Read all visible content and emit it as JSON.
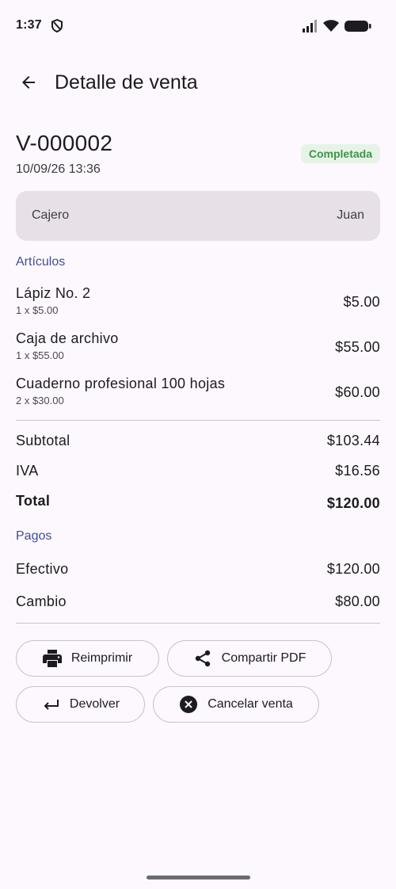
{
  "status_bar": {
    "time": "1:37"
  },
  "app_bar": {
    "title": "Detalle de venta"
  },
  "sale": {
    "id": "V-000002",
    "datetime": "10/09/26 13:36",
    "status": "Completada",
    "status_color": "#3f9448"
  },
  "cashier": {
    "label": "Cajero",
    "name": "Juan"
  },
  "articles": {
    "title": "Artículos",
    "items": [
      {
        "name": "Lápiz No. 2",
        "qty": "1 x $5.00",
        "amount": "$5.00"
      },
      {
        "name": "Caja de archivo",
        "qty": "1 x $55.00",
        "amount": "$55.00"
      },
      {
        "name": "Cuaderno profesional 100 hojas",
        "qty": "2 x $30.00",
        "amount": "$60.00"
      }
    ]
  },
  "totals": {
    "subtotal_label": "Subtotal",
    "subtotal": "$103.44",
    "tax_label": "IVA",
    "tax": "$16.56",
    "total_label": "Total",
    "total": "$120.00"
  },
  "payments": {
    "title": "Pagos",
    "cash_label": "Efectivo",
    "cash": "$120.00",
    "change_label": "Cambio",
    "change": "$80.00"
  },
  "actions": {
    "reprint": "Reimprimir",
    "share_pdf": "Compartir PDF",
    "refund": "Devolver",
    "cancel": "Cancelar venta"
  },
  "icons": {
    "back": "arrow-back-icon",
    "print": "print-icon",
    "share": "share-icon",
    "return": "return-arrow-icon",
    "cancel": "cancel-circle-icon"
  },
  "colors": {
    "accent": "#3f4f99",
    "card": "#e7e0e7",
    "background": "#fdf8fd"
  }
}
